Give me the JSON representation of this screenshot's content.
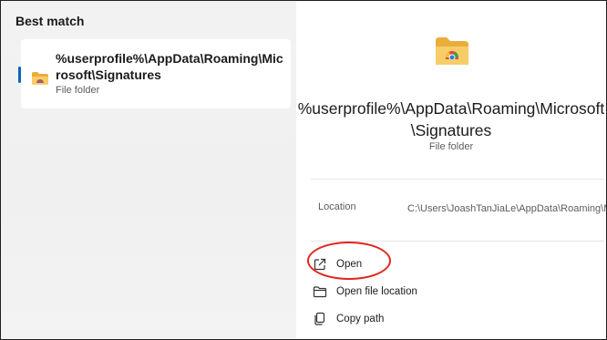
{
  "results": {
    "heading": "Best match",
    "item": {
      "title": "%userprofile%\\AppData\\Roaming\\Microsoft\\Signatures",
      "type": "File folder",
      "icon": "folder-icon"
    }
  },
  "details": {
    "title_line1": "%userprofile%\\AppData\\Roaming\\Microsoft",
    "title_line2": "\\Signatures",
    "type": "File folder",
    "location_label": "Location",
    "location_value": "C:\\Users\\JoashTanJiaLe\\AppData\\Roaming\\Microsoft",
    "actions": [
      {
        "label": "Open",
        "icon": "open-external-icon"
      },
      {
        "label": "Open file location",
        "icon": "folder-outline-icon"
      },
      {
        "label": "Copy path",
        "icon": "copy-icon"
      }
    ]
  },
  "colors": {
    "accent": "#0067c0",
    "annotation": "#e0261f",
    "folder": "#f2c35a"
  }
}
